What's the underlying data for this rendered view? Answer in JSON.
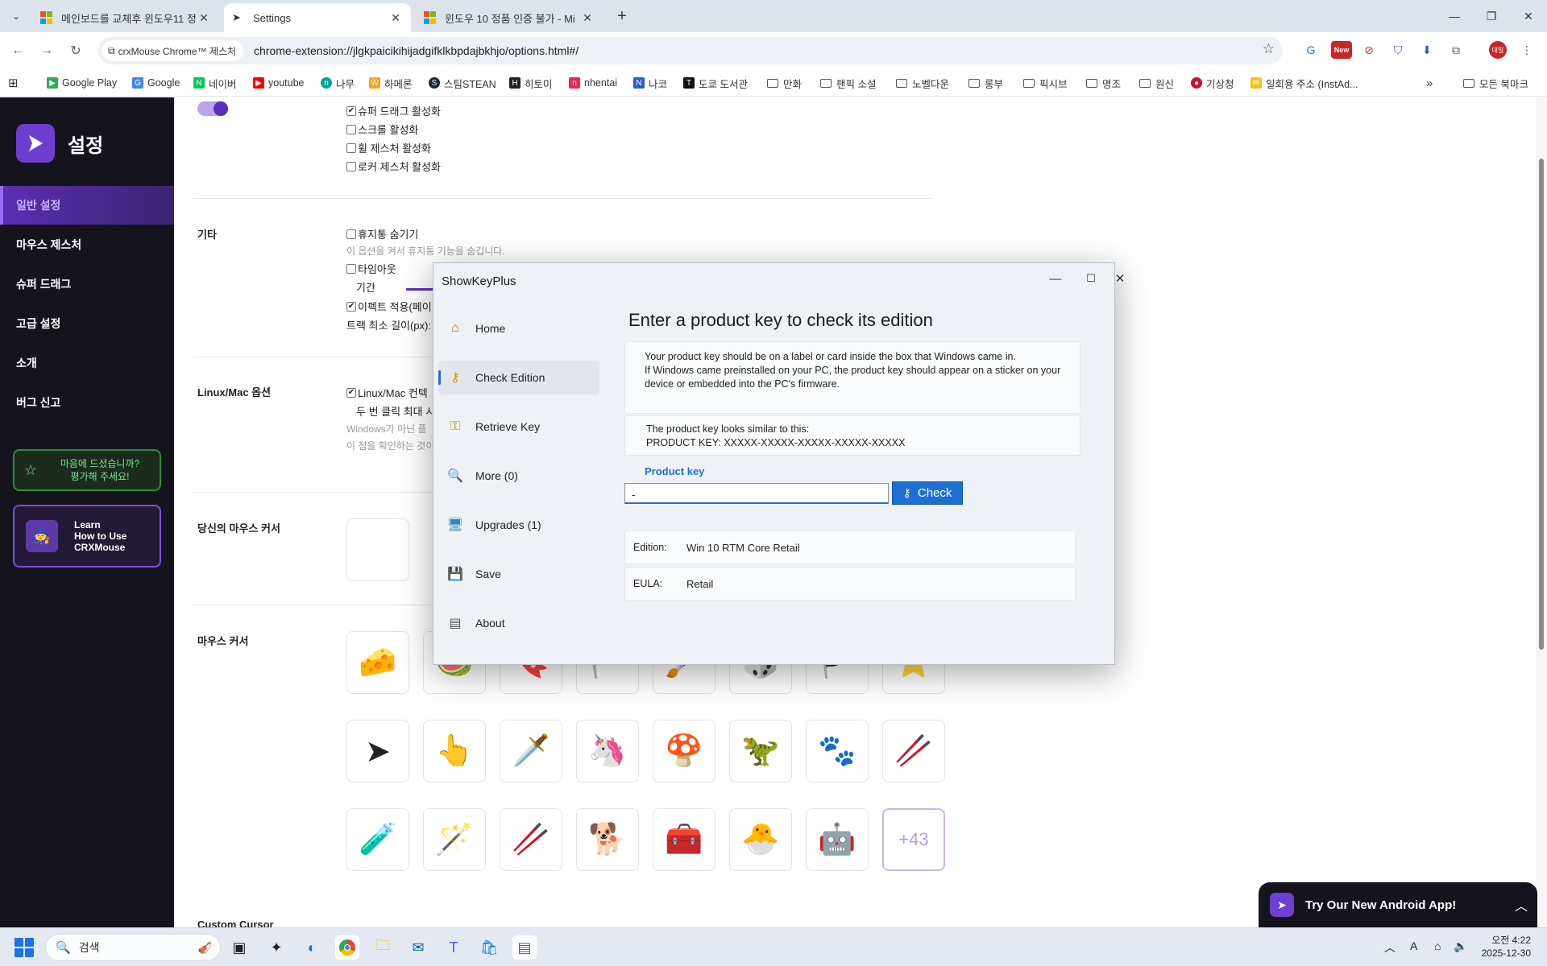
{
  "browser": {
    "tabs": [
      {
        "title": "메인보드를 교체후 윈도우11 정",
        "active": false
      },
      {
        "title": "Settings",
        "active": true
      },
      {
        "title": "윈도우 10 정품 인증 불가 - Mi",
        "active": false
      }
    ],
    "site_chip": "crxMouse Chrome™ 제스처",
    "url": "chrome-extension://jlgkpaicikihijadgifklkbpdajbkhjo/options.html#/",
    "new_badge": "New",
    "profile_badge": "대일",
    "bookmarks": [
      {
        "label": "Google Play",
        "icon": "google-play-icon",
        "color": "#34a853"
      },
      {
        "label": "Google",
        "icon": "google-icon",
        "color": "#4285f4"
      },
      {
        "label": "네이버",
        "icon": "naver-icon",
        "color": "#03c75a"
      },
      {
        "label": "youtube",
        "icon": "youtube-icon",
        "color": "#ff0000"
      },
      {
        "label": "나무",
        "icon": "namu-icon",
        "color": "#00a495"
      },
      {
        "label": "하메론",
        "icon": "hameron-icon",
        "color": "#f5a623"
      },
      {
        "label": "스팀STEAN",
        "icon": "steam-icon",
        "color": "#1b2838"
      },
      {
        "label": "히토미",
        "icon": "hitomi-icon",
        "color": "#222222"
      },
      {
        "label": "nhentai",
        "icon": "nhentai-icon",
        "color": "#ec2854"
      },
      {
        "label": "나코",
        "icon": "nako-icon",
        "color": "#2b5cd6"
      },
      {
        "label": "도쿄 도서관",
        "icon": "tokyo-icon",
        "color": "#111111"
      },
      {
        "label": "만화",
        "icon": "folder-icon",
        "color": ""
      },
      {
        "label": "팬픽 소설",
        "icon": "folder-icon",
        "color": ""
      },
      {
        "label": "노벨다운",
        "icon": "folder-icon",
        "color": ""
      },
      {
        "label": "롱부",
        "icon": "folder-icon",
        "color": ""
      },
      {
        "label": "픽시브",
        "icon": "folder-icon",
        "color": ""
      },
      {
        "label": "명조",
        "icon": "folder-icon",
        "color": ""
      },
      {
        "label": "원신",
        "icon": "folder-icon",
        "color": ""
      },
      {
        "label": "기상청",
        "icon": "kma-icon",
        "color": "#c8102e"
      },
      {
        "label": "일회용 주소 (InstAd...",
        "icon": "instaddr-icon",
        "color": "#f0c419"
      }
    ],
    "all_bookmarks": "모든 북마크"
  },
  "sidebar": {
    "title": "설정",
    "items": [
      {
        "label": "일반 설정",
        "active": true
      },
      {
        "label": "마우스 제스처",
        "active": false
      },
      {
        "label": "슈퍼 드래그",
        "active": false
      },
      {
        "label": "고급 설정",
        "active": false
      },
      {
        "label": "소개",
        "active": false
      },
      {
        "label": "버그 신고",
        "active": false
      }
    ],
    "rate_line1": "마음에 드셨습니까?",
    "rate_line2": "평가해 주세요!",
    "learn_line1": "Learn",
    "learn_line2": "How to Use",
    "learn_line3": "CRXMouse"
  },
  "settings": {
    "top_checks": [
      {
        "label": "슈퍼 드래그 활성화",
        "checked": true
      },
      {
        "label": "스크롤 활성화",
        "checked": false
      },
      {
        "label": "휠 제스처 활성화",
        "checked": false
      },
      {
        "label": "로커 제스처 활성화",
        "checked": false
      }
    ],
    "misc_label": "기타",
    "trash_label": "휴지통 숨기기",
    "trash_hint": "이 옵션을 켜서 휴지통 기능을 숨깁니다.",
    "timeout_label": "타임아웃",
    "duration_label": "기간",
    "effect_label": "이펙트 적용(페이",
    "track_label": "트랙 최소 길이(px):",
    "linux_section": "Linux/Mac 옵션",
    "linux_check": "Linux/Mac 컨텍",
    "dblclick_label": "두 번 클릭 최대 시",
    "linux_hint1": "Windows가 아닌 플",
    "linux_hint2": "이 점을 확인하는 것이",
    "your_cursor": "당신의 마우스 커서",
    "mouse_cursor": "마우스 커서",
    "cursors_row1": [
      "🧀",
      "🍉",
      "🔖",
      "🚩",
      "🖌️",
      "🎲",
      "🏴",
      "⭐"
    ],
    "cursors_row2": [
      "➤",
      "👆",
      "🗡️",
      "🦄",
      "🍄",
      "🦖",
      "🐾",
      "🥢"
    ],
    "cursors_row3": [
      "🧪",
      "🪄",
      "🥢",
      "🐕",
      "🧰",
      "🐣",
      "🤖"
    ],
    "more_count": "+43",
    "custom_cursor": "Custom Cursor"
  },
  "dialog": {
    "title": "ShowKeyPlus",
    "nav": [
      {
        "label": "Home",
        "icon": "home-icon",
        "selected": false
      },
      {
        "label": "Check Edition",
        "icon": "key-check-icon",
        "selected": true
      },
      {
        "label": "Retrieve Key",
        "icon": "key-icon",
        "selected": false
      },
      {
        "label": "More (0)",
        "icon": "more-icon",
        "selected": false
      },
      {
        "label": "Upgrades (1)",
        "icon": "upgrades-icon",
        "selected": false
      },
      {
        "label": "Save",
        "icon": "save-icon",
        "selected": false
      },
      {
        "label": "About",
        "icon": "about-icon",
        "selected": false
      }
    ],
    "heading": "Enter a product key to check its edition",
    "info1": "Your product key should be on a label or card inside the box that Windows came in.",
    "info2": "If Windows came preinstalled on your PC, the product key should appear on a sticker on your device or embedded into the PC's firmware.",
    "info3": "The product key looks similar to this:",
    "info4": "PRODUCT KEY: XXXXX-XXXXX-XXXXX-XXXXX-XXXXX",
    "product_key_label": "Product key",
    "product_key_value": "-",
    "check_label": "Check",
    "edition_key": "Edition:",
    "edition_value": "Win 10 RTM Core Retail",
    "eula_key": "EULA:",
    "eula_value": "Retail"
  },
  "android_toast": "Try Our New Android App!",
  "taskbar": {
    "search_placeholder": "검색",
    "time": "오전 4:22",
    "date": "2025-12-30"
  }
}
